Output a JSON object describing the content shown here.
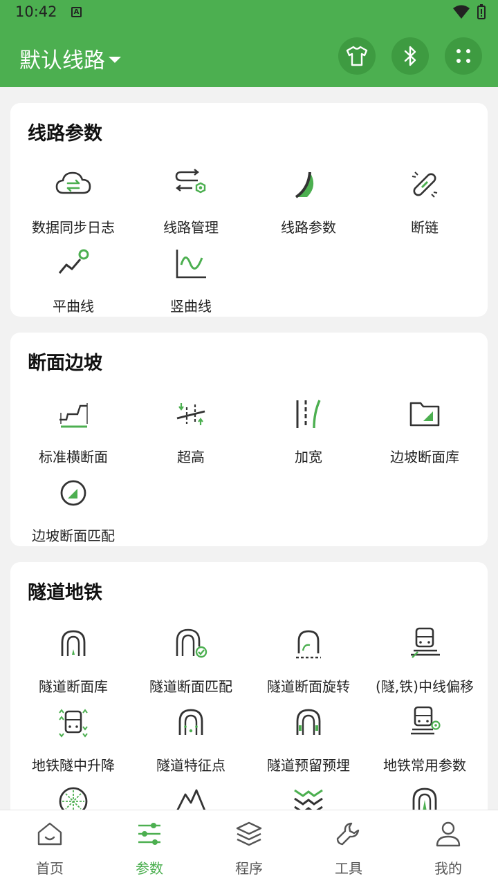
{
  "status_bar": {
    "time": "10:42",
    "notification_letter": "A"
  },
  "header": {
    "route_title": "默认线路"
  },
  "sections": [
    {
      "title": "线路参数",
      "items": [
        {
          "label": "数据同步日志",
          "icon": "cloud-sync-icon"
        },
        {
          "label": "线路管理",
          "icon": "route-manage-icon"
        },
        {
          "label": "线路参数",
          "icon": "curve-road-icon"
        },
        {
          "label": "断链",
          "icon": "broken-chain-icon"
        },
        {
          "label": "平曲线",
          "icon": "horizontal-curve-icon"
        },
        {
          "label": "竖曲线",
          "icon": "vertical-curve-icon"
        }
      ]
    },
    {
      "title": "断面边坡",
      "items": [
        {
          "label": "标准横断面",
          "icon": "cross-section-icon"
        },
        {
          "label": "超高",
          "icon": "superelevation-icon"
        },
        {
          "label": "加宽",
          "icon": "widening-icon"
        },
        {
          "label": "边坡断面库",
          "icon": "folder-slope-icon"
        },
        {
          "label": "边坡断面匹配",
          "icon": "slope-match-icon"
        }
      ]
    },
    {
      "title": "隧道地铁",
      "items": [
        {
          "label": "隧道断面库",
          "icon": "tunnel-icon"
        },
        {
          "label": "隧道断面匹配",
          "icon": "tunnel-check-icon"
        },
        {
          "label": "隧道断面旋转",
          "icon": "tunnel-rotate-icon"
        },
        {
          "label": "(隧,铁)中线偏移",
          "icon": "train-offset-icon"
        },
        {
          "label": "地铁隧中升降",
          "icon": "metro-lift-icon"
        },
        {
          "label": "隧道特征点",
          "icon": "tunnel-feature-icon"
        },
        {
          "label": "隧道预留预埋",
          "icon": "tunnel-embed-icon"
        },
        {
          "label": "地铁常用参数",
          "icon": "metro-param-icon"
        },
        {
          "label": "",
          "icon": "tunnel-circle-icon"
        },
        {
          "label": "",
          "icon": "mountain-icon"
        },
        {
          "label": "",
          "icon": "layers-wave-icon"
        },
        {
          "label": "",
          "icon": "tunnel-green-icon"
        }
      ]
    }
  ],
  "bottom_nav": [
    {
      "label": "首页",
      "icon": "home-icon"
    },
    {
      "label": "参数",
      "icon": "sliders-icon"
    },
    {
      "label": "程序",
      "icon": "layers-icon"
    },
    {
      "label": "工具",
      "icon": "wrench-icon"
    },
    {
      "label": "我的",
      "icon": "user-icon"
    }
  ],
  "colors": {
    "primary": "#4caf50",
    "primary_dark": "#3e9b41",
    "icon_dark": "#333333",
    "background": "#f2f2f2"
  }
}
